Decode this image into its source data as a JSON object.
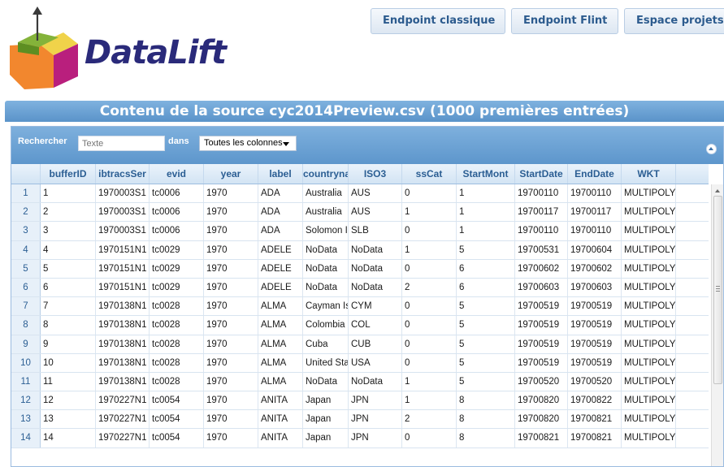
{
  "logo": {
    "text": "DataLift",
    "icon": "datalift-cube-logo"
  },
  "nav": {
    "classic_label": "Endpoint classique",
    "flint_label": "Endpoint Flint",
    "projects_label": "Espace projets"
  },
  "title": "Contenu de la source cyc2014Preview.csv (1000 premières entrées)",
  "toolbar": {
    "search_label": "Rechercher",
    "search_placeholder": "Texte",
    "in_label": "dans",
    "column_select": "Toutes les colonnes",
    "collapse_icon": "collapse-up-icon"
  },
  "columns": [
    "",
    "bufferID",
    "ibtracsSer",
    "evid",
    "year",
    "label",
    "countryna",
    "ISO3",
    "ssCat",
    "StartMont",
    "StartDate",
    "EndDate",
    "WKT"
  ],
  "rows": [
    [
      "1",
      "1",
      "1970003S1",
      "tc0006",
      "1970",
      "ADA",
      "Australia",
      "AUS",
      "0",
      "1",
      "19700110",
      "19700110",
      "MULTIPOLY"
    ],
    [
      "2",
      "2",
      "1970003S1",
      "tc0006",
      "1970",
      "ADA",
      "Australia",
      "AUS",
      "1",
      "1",
      "19700117",
      "19700117",
      "MULTIPOLY"
    ],
    [
      "3",
      "3",
      "1970003S1",
      "tc0006",
      "1970",
      "ADA",
      "Solomon Is",
      "SLB",
      "0",
      "1",
      "19700110",
      "19700110",
      "MULTIPOLY"
    ],
    [
      "4",
      "4",
      "1970151N1",
      "tc0029",
      "1970",
      "ADELE",
      "NoData",
      "NoData",
      "1",
      "5",
      "19700531",
      "19700604",
      "MULTIPOLY"
    ],
    [
      "5",
      "5",
      "1970151N1",
      "tc0029",
      "1970",
      "ADELE",
      "NoData",
      "NoData",
      "0",
      "6",
      "19700602",
      "19700602",
      "MULTIPOLY"
    ],
    [
      "6",
      "6",
      "1970151N1",
      "tc0029",
      "1970",
      "ADELE",
      "NoData",
      "NoData",
      "2",
      "6",
      "19700603",
      "19700603",
      "MULTIPOLY"
    ],
    [
      "7",
      "7",
      "1970138N1",
      "tc0028",
      "1970",
      "ALMA",
      "Cayman Isl",
      "CYM",
      "0",
      "5",
      "19700519",
      "19700519",
      "MULTIPOLY"
    ],
    [
      "8",
      "8",
      "1970138N1",
      "tc0028",
      "1970",
      "ALMA",
      "Colombia",
      "COL",
      "0",
      "5",
      "19700519",
      "19700519",
      "MULTIPOLY"
    ],
    [
      "9",
      "9",
      "1970138N1",
      "tc0028",
      "1970",
      "ALMA",
      "Cuba",
      "CUB",
      "0",
      "5",
      "19700519",
      "19700519",
      "MULTIPOLY"
    ],
    [
      "10",
      "10",
      "1970138N1",
      "tc0028",
      "1970",
      "ALMA",
      "United Stat",
      "USA",
      "0",
      "5",
      "19700519",
      "19700519",
      "MULTIPOLY"
    ],
    [
      "11",
      "11",
      "1970138N1",
      "tc0028",
      "1970",
      "ALMA",
      "NoData",
      "NoData",
      "1",
      "5",
      "19700520",
      "19700520",
      "MULTIPOLY"
    ],
    [
      "12",
      "12",
      "1970227N1",
      "tc0054",
      "1970",
      "ANITA",
      "Japan",
      "JPN",
      "1",
      "8",
      "19700820",
      "19700822",
      "MULTIPOLY"
    ],
    [
      "13",
      "13",
      "1970227N1",
      "tc0054",
      "1970",
      "ANITA",
      "Japan",
      "JPN",
      "2",
      "8",
      "19700820",
      "19700821",
      "MULTIPOLY"
    ],
    [
      "14",
      "14",
      "1970227N1",
      "tc0054",
      "1970",
      "ANITA",
      "Japan",
      "JPN",
      "0",
      "8",
      "19700821",
      "19700821",
      "MULTIPOLY"
    ]
  ]
}
